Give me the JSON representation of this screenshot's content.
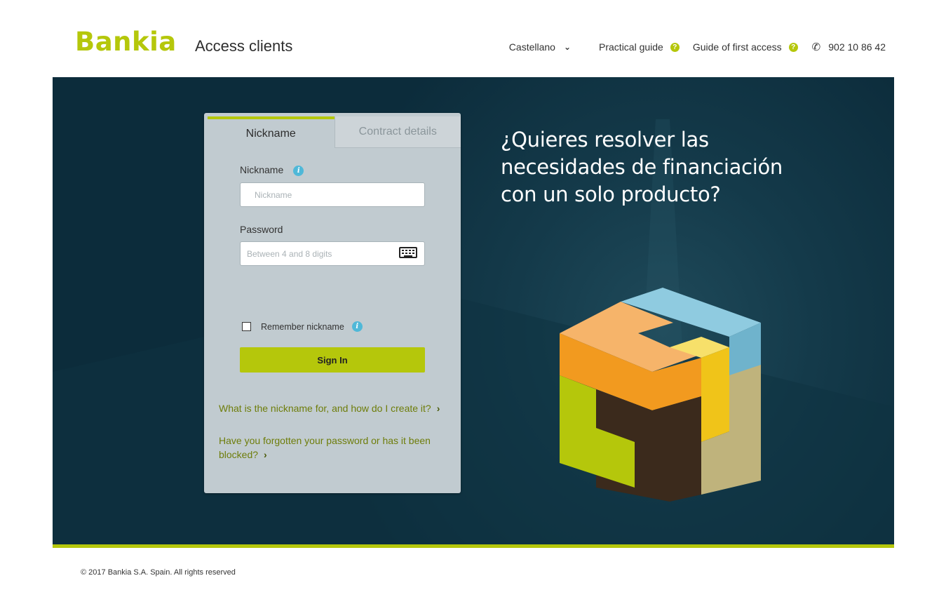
{
  "brand": {
    "logo_text": "Bankia",
    "accent_color": "#b5c70b"
  },
  "header": {
    "title": "Access clients",
    "language": "Castellano",
    "practical_guide": "Practical guide",
    "first_access_guide": "Guide of first access",
    "phone": "902 10 86 42",
    "help_glyph": "?"
  },
  "login": {
    "tabs": [
      {
        "label": "Nickname",
        "active": true
      },
      {
        "label": "Contract details",
        "active": false
      }
    ],
    "nickname_label": "Nickname",
    "nickname_placeholder": "Nickname",
    "password_label": "Password",
    "password_placeholder": "Between 4 and 8 digits",
    "remember_label": "Remember nickname",
    "remember_checked": false,
    "signin_label": "Sign In",
    "info_glyph": "i",
    "links": [
      "What is the nickname for, and how do I create it?",
      "Have you forgotten your password or has it been blocked?"
    ]
  },
  "hero": {
    "headline": "¿Quieres resolver las necesidades de financiación con un solo producto?"
  },
  "footer": {
    "copyright": "© 2017 Bankia S.A. Spain. All rights reserved"
  }
}
